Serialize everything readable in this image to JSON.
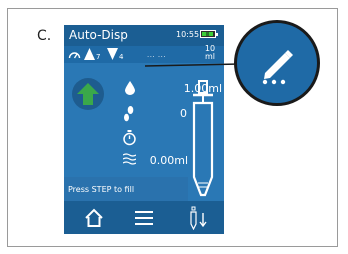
{
  "figure_label": "C.",
  "app": {
    "title": "Auto-Disp",
    "time": "10:55"
  },
  "info_bar": {
    "speed_up_value": "7",
    "speed_down_value": "4",
    "ticks_value": "... ...",
    "pipette_volume_value": "10",
    "pipette_volume_unit": "ml"
  },
  "rows": {
    "volume": "1.00ml",
    "count": "0",
    "dispensed": "0.00ml"
  },
  "status": "Press STEP to fill",
  "colors": {
    "screen_blue": "#2a78b5",
    "bar_blue": "#1b5e93",
    "fill_arrow_green": "#3aa84a",
    "battery_green": "#3ccf38"
  },
  "icons": [
    "speed-icon",
    "up-triangle-icon",
    "down-triangle-icon",
    "fill-arrow-icon",
    "drop-icon",
    "footsteps-icon",
    "timer-icon",
    "wave-icon",
    "home-icon",
    "menu-icon",
    "tip-eject-icon",
    "pencil-edit-icon"
  ]
}
